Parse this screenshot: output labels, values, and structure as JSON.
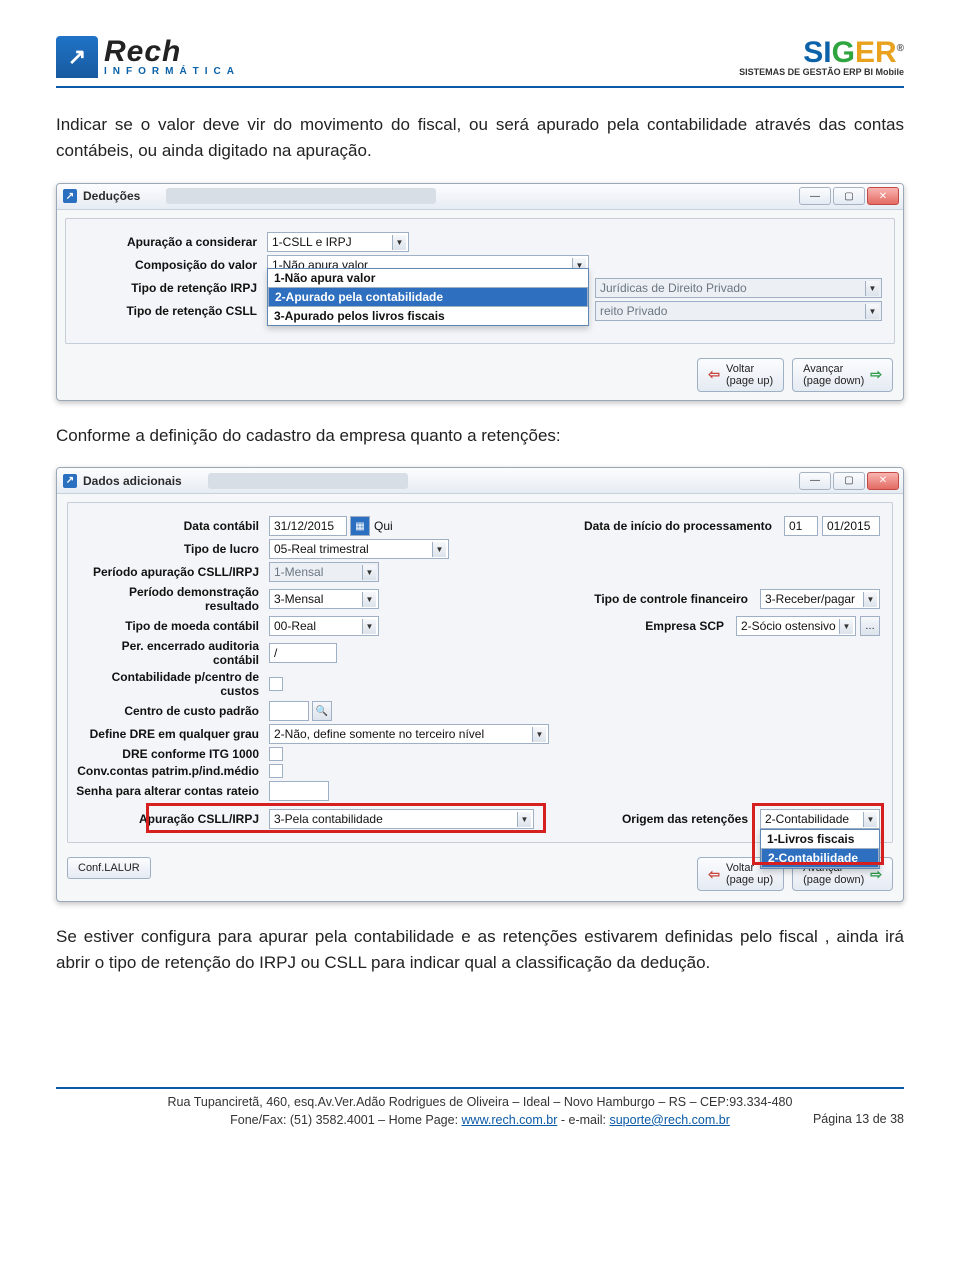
{
  "header": {
    "logo_left_brand": "Rech",
    "logo_left_sub": "INFORMÁTICA",
    "logo_right_brand": "SIGER",
    "logo_right_sub": "SISTEMAS DE GESTÃO  ERP  BI  Mobile"
  },
  "paragraphs": {
    "p1": "Indicar se o valor deve vir do movimento do fiscal, ou será apurado pela contabilidade através das contas contábeis, ou ainda digitado na apuração.",
    "p2": "Conforme a definição do cadastro da empresa quanto a retenções:",
    "p3": "Se estiver configura para apurar pela contabilidade e as retenções estivarem definidas pelo fiscal , ainda irá abrir o tipo de retenção do IRPJ ou CSLL para indicar qual a classificação da dedução."
  },
  "window1": {
    "title": "Deduções",
    "labels": {
      "apuracao": "Apuração a considerar",
      "composicao": "Composição do valor",
      "tipo_irpj": "Tipo de retenção IRPJ",
      "tipo_csll": "Tipo de retenção CSLL"
    },
    "values": {
      "apuracao": "1-CSLL e IRPJ",
      "composicao": "1-Não apura valor",
      "right_line_a": "Jurídicas de Direito Privado",
      "right_line_b": "reito Privado"
    },
    "dropdown_options": [
      "1-Não apura valor",
      "2-Apurado pela contabilidade",
      "3-Apurado pelos livros fiscais"
    ],
    "nav": {
      "back_top": "Voltar",
      "back_bottom": "(page up)",
      "fwd_top": "Avançar",
      "fwd_bottom": "(page down)"
    }
  },
  "window2": {
    "title": "Dados adicionais",
    "labels": {
      "data_contabil": "Data contábil",
      "dia_sem": "Qui",
      "data_inicio": "Data de início do processamento",
      "tipo_lucro": "Tipo de lucro",
      "periodo_csll": "Período apuração CSLL/IRPJ",
      "periodo_dre": "Período demonstração resultado",
      "tipo_controle": "Tipo de controle financeiro",
      "tipo_moeda": "Tipo de moeda contábil",
      "empresa_scp": "Empresa SCP",
      "per_auditoria": "Per. encerrado auditoria contábil",
      "centro_custos": "Contabilidade p/centro de custos",
      "cc_padrao": "Centro de custo padrão",
      "define_dre": "Define DRE em qualquer grau",
      "dre_itg": "DRE conforme ITG 1000",
      "conv_contas": "Conv.contas patrim.p/ind.médio",
      "senha": "Senha para alterar contas rateio",
      "apuracao_csll": "Apuração CSLL/IRPJ",
      "origem_ret": "Origem das retenções",
      "conf_lalur": "Conf.LALUR"
    },
    "values": {
      "data_contabil": "31/12/2015",
      "data_inicio_dia": "01",
      "data_inicio_mesano": "01/2015",
      "tipo_lucro": "05-Real trimestral",
      "periodo_csll": "1-Mensal",
      "periodo_dre": "3-Mensal",
      "tipo_controle": "3-Receber/pagar",
      "tipo_moeda": "00-Real",
      "empresa_scp": "2-Sócio ostensivo",
      "per_auditoria": "/",
      "define_dre": "2-Não, define somente no terceiro nível",
      "apuracao_csll": "3-Pela contabilidade",
      "origem_ret": "2-Contabilidade"
    },
    "origem_options": [
      "1-Livros fiscais",
      "2-Contabilidade"
    ],
    "nav": {
      "back_top": "Voltar",
      "back_bottom": "(page up)",
      "fwd_top": "Avançar",
      "fwd_bottom": "(page down)"
    }
  },
  "footer": {
    "line1_a": "Rua Tupanciretã, 460, esq.Av.Ver.Adão Rodrigues de Oliveira – Ideal   –   Novo Hamburgo   –   RS   –   CEP:93.334-480",
    "line2_a": "Fone/Fax: (51) 3582.4001 – Home Page: ",
    "link1": "www.rech.com.br",
    "line2_b": " - e-mail: ",
    "link2": "suporte@rech.com.br",
    "page": "Página 13 de 38"
  }
}
